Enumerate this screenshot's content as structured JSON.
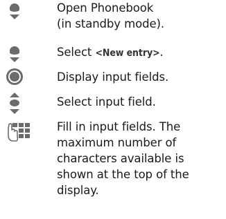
{
  "steps": [
    {
      "icon": "navigation-key-down-icon",
      "lines": [
        "Open Phonebook",
        "(in standby mode)."
      ]
    },
    {
      "icon": "navigation-key-down-icon",
      "prefix": "Select ",
      "highlight": "<New entry>",
      "suffix": "."
    },
    {
      "icon": "center-key-icon",
      "lines": [
        "Display input fields."
      ]
    },
    {
      "icon": "navigation-key-up-down-icon",
      "lines": [
        "Select input field."
      ]
    },
    {
      "icon": "keypad-hand-icon",
      "lines": [
        "Fill in input fields. The",
        "maximum number of",
        "characters available is",
        "shown at the top of the",
        "display."
      ]
    }
  ]
}
